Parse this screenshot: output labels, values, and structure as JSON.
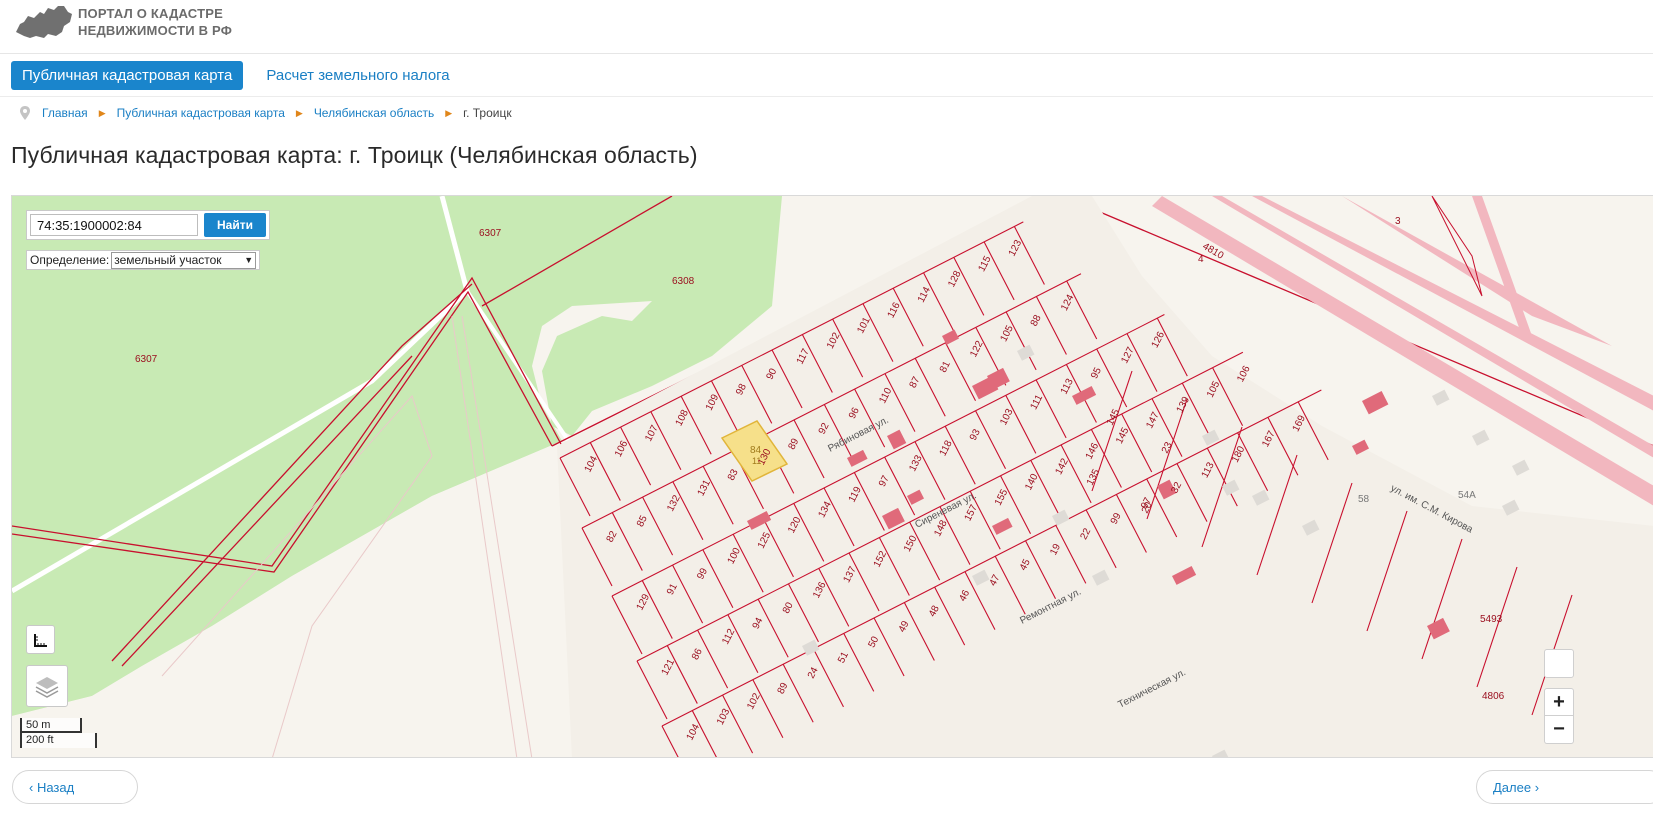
{
  "header": {
    "logo_line1": "ПОРТАЛ О КАДАСТРЕ",
    "logo_line2": "НЕДВИЖИМОСТИ В РФ",
    "logo_icon": "russia-map-icon"
  },
  "nav": {
    "tabs": [
      {
        "label": "Публичная кадастровая карта",
        "active": true
      },
      {
        "label": "Расчет земельного налога",
        "active": false
      }
    ]
  },
  "breadcrumb": {
    "items": [
      "Главная",
      "Публичная кадастровая карта",
      "Челябинская область",
      "г. Троицк"
    ]
  },
  "page": {
    "title": "Публичная кадастровая карта: г. Троицк (Челябинская область)"
  },
  "map": {
    "search_value": "74:35:1900002:84",
    "search_button": "Найти",
    "definition_label": "Определение:",
    "definition_value": "земельный участок",
    "scale_m": "50 m",
    "scale_ft": "200 ft",
    "zoom_in": "+",
    "zoom_out": "−",
    "streets": {
      "ryabinovaya": "Рябиновая ул.",
      "sirenevaya": "Сиреневая ул.",
      "remontnaya": "Ремонтная ул.",
      "tekhnicheskaya": "Техническая ул.",
      "kirova": "ул. им. С.М. Кирова"
    },
    "zone_labels": {
      "z6307a": "6307",
      "z6307b": "6307",
      "z6308": "6308",
      "z4810": "4810",
      "z3": "3",
      "z4": "4",
      "z5493": "5493",
      "z4806": "4806",
      "z58": "58",
      "z54a": "54А"
    },
    "selected_parcel": {
      "number": "84",
      "sub": "11"
    },
    "parcel_labels": [
      "104",
      "106",
      "107",
      "108",
      "109",
      "98",
      "90",
      "117",
      "102",
      "101",
      "116",
      "114",
      "128",
      "115",
      "123",
      "82",
      "85",
      "132",
      "131",
      "83",
      "130",
      "89",
      "92",
      "96",
      "110",
      "87",
      "81",
      "122",
      "105",
      "88",
      "124",
      "129",
      "91",
      "99",
      "100",
      "125",
      "120",
      "134",
      "119",
      "97",
      "133",
      "118",
      "93",
      "103",
      "111",
      "113",
      "95",
      "127",
      "126",
      "121",
      "86",
      "112",
      "94",
      "80",
      "136",
      "137",
      "152",
      "150",
      "148",
      "157",
      "155",
      "140",
      "142",
      "146",
      "145",
      "147",
      "139",
      "105",
      "106",
      "104",
      "103",
      "102",
      "89",
      "24",
      "51",
      "50",
      "49",
      "48",
      "46",
      "47",
      "45",
      "19",
      "22",
      "99",
      "97",
      "32",
      "113",
      "180",
      "167",
      "169",
      "145",
      "135",
      "23",
      "20"
    ],
    "colors": {
      "parcel_border": "#c8102e",
      "building": "#e06a7a",
      "forest": "#c8eab4",
      "road": "#fbe9a0",
      "selected": "#f6e08a",
      "background": "#f7f4ee"
    }
  },
  "bottom": {
    "prev_label": "‹ Назад",
    "next_label": "Далее ›"
  }
}
